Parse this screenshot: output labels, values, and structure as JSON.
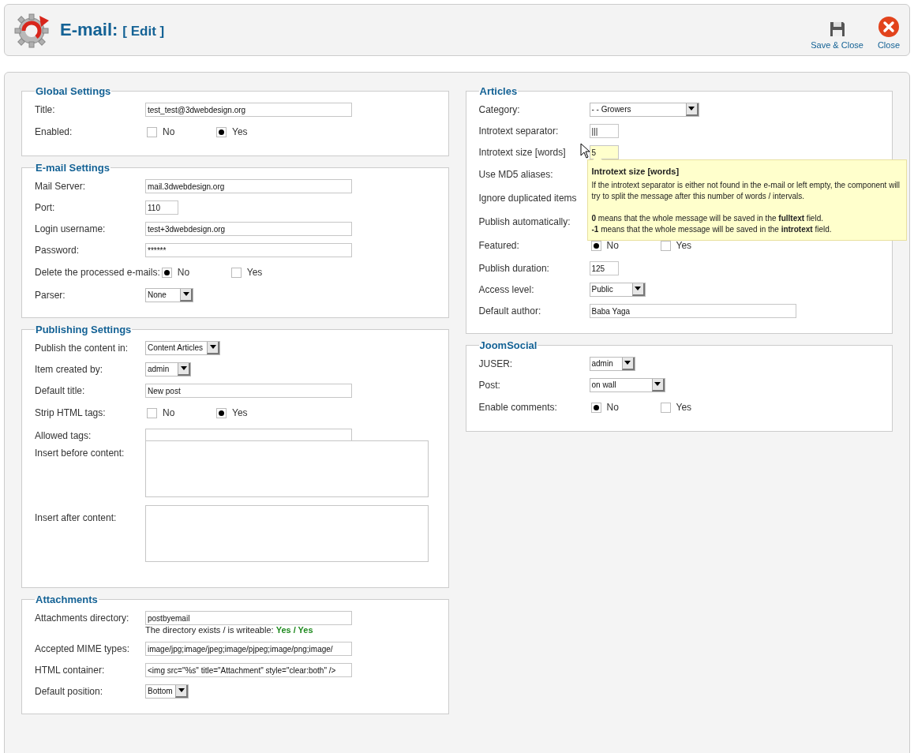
{
  "header": {
    "title": "E-mail:",
    "subtitle": "[ Edit ]",
    "buttons": [
      {
        "kind": "save",
        "label": "Save & Close"
      },
      {
        "kind": "close",
        "label": "Close"
      }
    ]
  },
  "columns": [
    {
      "sections": [
        {
          "title": "Global Settings",
          "rows": [
            {
              "label": "Title:",
              "kind": "text",
              "value": "test_test@3dwebdesign.org"
            },
            {
              "label": "Enabled:",
              "kind": "radio",
              "options": [
                {
                  "label": "No",
                  "selected": false
                },
                {
                  "label": "Yes",
                  "selected": true
                }
              ]
            }
          ]
        },
        {
          "title": "E-mail Settings",
          "rows": [
            {
              "label": "Mail Server:",
              "kind": "text",
              "value": "mail.3dwebdesign.org"
            },
            {
              "label": "Port:",
              "kind": "text",
              "value": "110"
            },
            {
              "label": "Login username:",
              "kind": "text",
              "value": "test+3dwebdesign.org"
            },
            {
              "label": "Password:",
              "kind": "text",
              "value": "******"
            },
            {
              "label": "Delete the processed e-mails:",
              "kind": "radio",
              "options": [
                {
                  "label": "No",
                  "selected": true
                },
                {
                  "label": "Yes",
                  "selected": false
                }
              ]
            },
            {
              "label": "Parser:",
              "kind": "select",
              "value": "None"
            }
          ]
        },
        {
          "title": "Publishing Settings",
          "rows": [
            {
              "label": "Publish the content in:",
              "kind": "select",
              "value": "Content Articles"
            },
            {
              "label": "Item created by:",
              "kind": "select",
              "value": "admin"
            },
            {
              "label": "Default title:",
              "kind": "text",
              "value": "New post"
            },
            {
              "label": "Strip HTML tags:",
              "kind": "radio",
              "options": [
                {
                  "label": "No",
                  "selected": false
                },
                {
                  "label": "Yes",
                  "selected": true
                }
              ]
            },
            {
              "label": "Allowed tags:",
              "kind": "text"
            },
            {
              "label": "Insert before content:",
              "kind": "textarea"
            },
            {
              "label": "Insert after content:",
              "kind": "textarea"
            }
          ]
        },
        {
          "title": "Attachments",
          "rows": [
            {
              "label": "Attachments directory:",
              "kind": "text",
              "value": "postbyemail"
            },
            {
              "kind": "note",
              "text": "The directory exists / is writeable:",
              "status": "Yes / Yes"
            },
            {
              "label": "Accepted MIME types:",
              "kind": "text",
              "value": "image/jpg;image/jpeg;image/pjpeg;image/png;image/"
            },
            {
              "label": "HTML container:",
              "kind": "text",
              "value": "<img src=\"%s\" title=\"Attachment\" style=\"clear:both\" />"
            },
            {
              "label": "Default position:",
              "kind": "select",
              "value": "Bottom"
            }
          ]
        }
      ]
    },
    {
      "sections": [
        {
          "title": "Articles",
          "rows": [
            {
              "label": "Category:",
              "kind": "select",
              "value": "- - Growers"
            },
            {
              "label": "Introtext separator:",
              "kind": "text",
              "value": "|||"
            },
            {
              "label": "Introtext size [words]",
              "kind": "text",
              "value": "5",
              "focused": true,
              "tooltip": {
                "title": "Introtext size [words]",
                "lines": [
                  "If the introtext separator is either not found in the e-mail or left empty, the component will try to split the message after this number of words / intervals.",
                  "**0** means that the whole message will be saved in the **fulltext** field.",
                  "**-1** means that the whole message will be saved in the **introtext** field."
                ]
              }
            },
            {
              "label": "Use MD5 aliases:",
              "kind": "covered"
            },
            {
              "label": "Ignore duplicated items",
              "kind": "covered"
            },
            {
              "label": "Publish automatically:",
              "kind": "covered"
            },
            {
              "label": "Featured:",
              "kind": "radio",
              "options": [
                {
                  "label": "No",
                  "selected": true
                },
                {
                  "label": "Yes",
                  "selected": false
                }
              ]
            },
            {
              "label": "Publish duration:",
              "kind": "text",
              "value": "125"
            },
            {
              "label": "Access level:",
              "kind": "select",
              "value": "Public"
            },
            {
              "label": "Default author:",
              "kind": "text",
              "value": "Baba Yaga"
            }
          ]
        },
        {
          "title": "JoomSocial",
          "rows": [
            {
              "label": "JUSER:",
              "kind": "select",
              "value": "admin"
            },
            {
              "label": "Post:",
              "kind": "select",
              "value": "on wall"
            },
            {
              "label": "Enable comments:",
              "kind": "radio",
              "options": [
                {
                  "label": "No",
                  "selected": true
                },
                {
                  "label": "Yes",
                  "selected": false
                }
              ]
            }
          ]
        }
      ]
    }
  ]
}
